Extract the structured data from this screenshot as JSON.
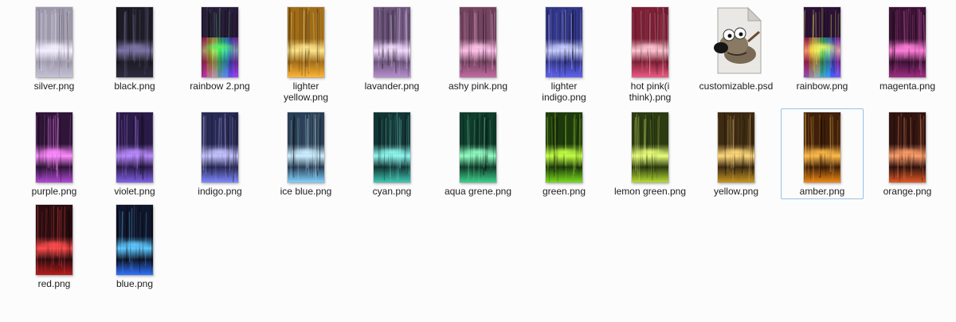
{
  "files": [
    {
      "name": "silver.png",
      "type": "png",
      "hue": "silver",
      "base": "#9d98aa",
      "glow": "#f4f0ff",
      "bottom": "#c6c2d6"
    },
    {
      "name": "black.png",
      "type": "png",
      "hue": "black",
      "base": "#1d1b24",
      "glow": "#7d76a6",
      "bottom": "#2f2b3f"
    },
    {
      "name": "rainbow 2.png",
      "type": "png",
      "hue": "rainbow",
      "base": "#2a1d3c",
      "glow": "#59f06e",
      "bottom": "#8a3ff0"
    },
    {
      "name": "lighter yellow.png",
      "type": "png",
      "hue": "lighter-yellow",
      "base": "#a16c18",
      "glow": "#ffe58c",
      "bottom": "#ffb636"
    },
    {
      "name": "lavander.png",
      "type": "png",
      "hue": "lavander",
      "base": "#6d557c",
      "glow": "#f3dcff",
      "bottom": "#b790cf"
    },
    {
      "name": "ashy pink.png",
      "type": "png",
      "hue": "ashy-pink",
      "base": "#744460",
      "glow": "#ffc2ea",
      "bottom": "#c26ba2"
    },
    {
      "name": "lighter indigo.png",
      "type": "png",
      "hue": "lighter-indigo",
      "base": "#333789",
      "glow": "#c9cfff",
      "bottom": "#5f64f0"
    },
    {
      "name": "hot pink(i think).png",
      "type": "png",
      "hue": "hot-pink",
      "base": "#7c1f35",
      "glow": "#ffc6d3",
      "bottom": "#ef5a83"
    },
    {
      "name": "customizable.psd",
      "type": "psd",
      "hue": "gimp",
      "base": "#d8d5cc",
      "glow": "#ffffff",
      "bottom": "#7a6a55"
    },
    {
      "name": "rainbow.png",
      "type": "png",
      "hue": "rainbow",
      "base": "#2b1236",
      "glow": "#f4f460",
      "bottom": "#3f6bff"
    },
    {
      "name": "magenta.png",
      "type": "png",
      "hue": "magenta",
      "base": "#3b1234",
      "glow": "#ff7ed9",
      "bottom": "#a22e84"
    },
    {
      "name": "purple.png",
      "type": "png",
      "hue": "purple",
      "base": "#2f1538",
      "glow": "#ff8bff",
      "bottom": "#b24ad6"
    },
    {
      "name": "violet.png",
      "type": "png",
      "hue": "violet",
      "base": "#2b1b48",
      "glow": "#b98bff",
      "bottom": "#8062e8"
    },
    {
      "name": "indigo.png",
      "type": "png",
      "hue": "indigo",
      "base": "#2a2a56",
      "glow": "#c4c3ff",
      "bottom": "#7f88ff"
    },
    {
      "name": "ice blue.png",
      "type": "png",
      "hue": "ice-blue",
      "base": "#2a3f55",
      "glow": "#cdefff",
      "bottom": "#82d4ff"
    },
    {
      "name": "cyan.png",
      "type": "png",
      "hue": "cyan",
      "base": "#123534",
      "glow": "#8ff8ef",
      "bottom": "#41c9b5"
    },
    {
      "name": "aqua grene.png",
      "type": "png",
      "hue": "aqua-green",
      "base": "#103d2c",
      "glow": "#91ffc2",
      "bottom": "#3ed18b"
    },
    {
      "name": "green.png",
      "type": "png",
      "hue": "green",
      "base": "#1d3a0c",
      "glow": "#c2ff45",
      "bottom": "#7bdc1f"
    },
    {
      "name": "lemon green.png",
      "type": "png",
      "hue": "lemon-green",
      "base": "#2c3b11",
      "glow": "#e9ff7a",
      "bottom": "#b7de35"
    },
    {
      "name": "yellow.png",
      "type": "png",
      "hue": "yellow",
      "base": "#3d2a12",
      "glow": "#ffd97a",
      "bottom": "#c79723"
    },
    {
      "name": "amber.png",
      "type": "png",
      "hue": "amber",
      "base": "#40200a",
      "glow": "#ffbb4a",
      "bottom": "#f08a14"
    },
    {
      "name": "orange.png",
      "type": "png",
      "hue": "orange",
      "base": "#321410",
      "glow": "#ff9f6b",
      "bottom": "#e35a26"
    },
    {
      "name": "red.png",
      "type": "png",
      "hue": "red",
      "base": "#2a0d10",
      "glow": "#ff4d4d",
      "bottom": "#b91c1c"
    },
    {
      "name": "blue.png",
      "type": "png",
      "hue": "blue",
      "base": "#10162b",
      "glow": "#5fc8ff",
      "bottom": "#2d73ff"
    }
  ],
  "selected_index": 20
}
